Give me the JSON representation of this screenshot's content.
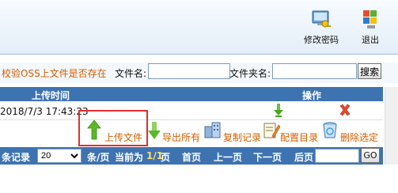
{
  "header": {
    "tools": [
      {
        "label": "修改密码",
        "icon": "password-key-icon"
      },
      {
        "label": "退出",
        "icon": "windows-logout-icon"
      }
    ]
  },
  "search": {
    "verify_link": "校验OSS上文件是否存在",
    "filename_label": "文件名:",
    "filename_value": "",
    "folder_label": "文件夹名:",
    "folder_value": "",
    "search_button": "搜索"
  },
  "table": {
    "columns": {
      "upload_time": "上传时间",
      "operation": "操作"
    },
    "rows": [
      {
        "upload_time": "2018/7/3 17:43:23",
        "ops": [
          "download-arrow-icon",
          "delete-x-icon"
        ]
      }
    ]
  },
  "actions": {
    "upload": "上传文件",
    "export_all": "导出所有",
    "copy_records": "复制记录",
    "config_dir": "配置目录",
    "delete_selected": "删除选定"
  },
  "pager": {
    "records_suffix": "条记录",
    "page_size": "20",
    "per_page_suffix": "条/页",
    "current_prefix": "当前为",
    "current_page": "1/1",
    "page_suffix": "页",
    "first": "首页",
    "prev": "上一页",
    "next": "下一页",
    "last": "后页",
    "goto_value": "",
    "go_button": "GO"
  },
  "colors": {
    "accent": "#3e73b1",
    "link_orange": "#d45d00",
    "highlight": "#e03030"
  }
}
